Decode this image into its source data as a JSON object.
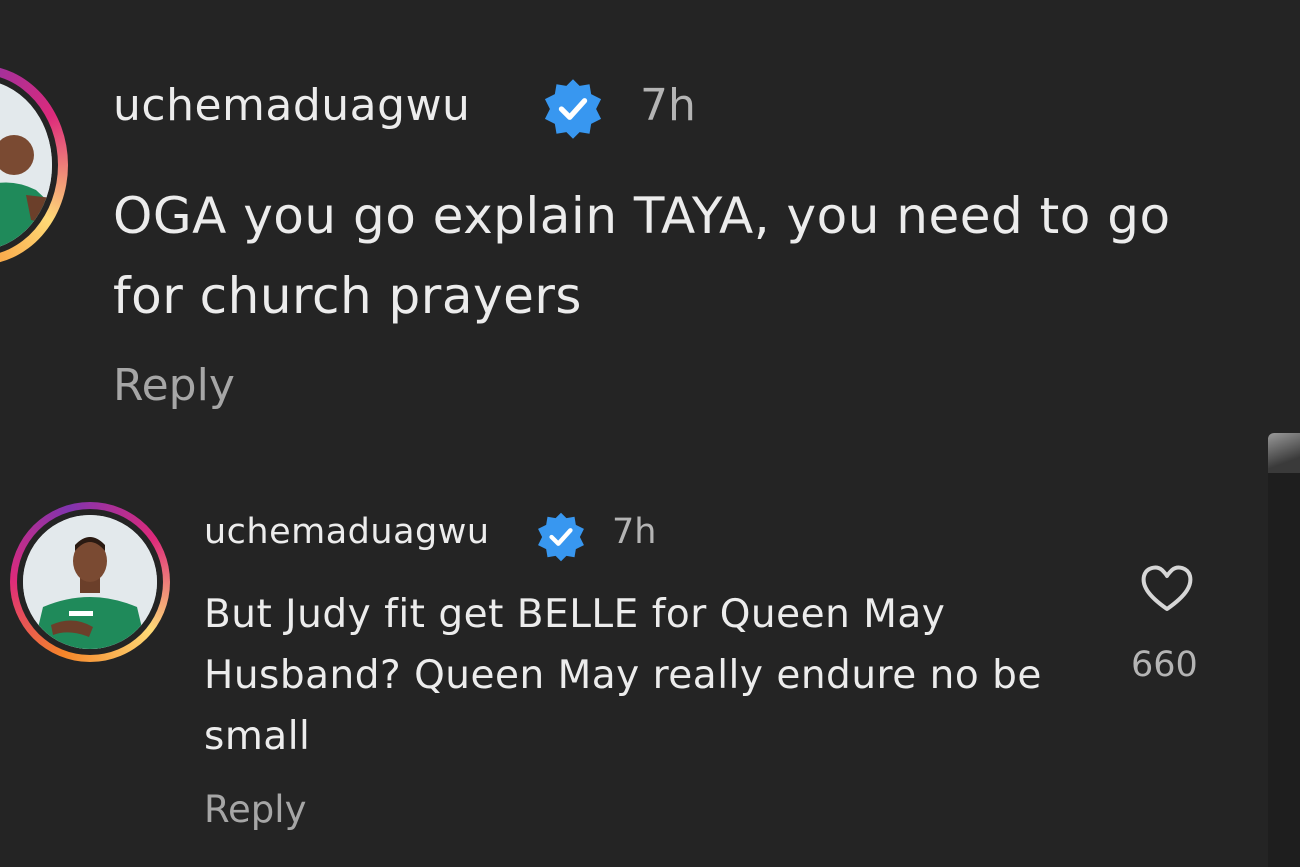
{
  "comments": [
    {
      "username": "uchemaduagwu",
      "verified_icon": "verified-badge-icon",
      "time": "7h",
      "text": "OGA you go explain TAYA, you need to go for church prayers",
      "reply_label": "Reply"
    },
    {
      "username": "uchemaduagwu",
      "verified_icon": "verified-badge-icon",
      "time": "7h",
      "text": "But Judy fit get BELLE for Queen May Husband? Queen May really endure no be small",
      "reply_label": "Reply",
      "like_icon": "heart-icon",
      "like_count": "660"
    }
  ],
  "colors": {
    "background": "#242424",
    "text": "#ececec",
    "muted": "#a6a6a6",
    "verified": "#3897f0"
  }
}
